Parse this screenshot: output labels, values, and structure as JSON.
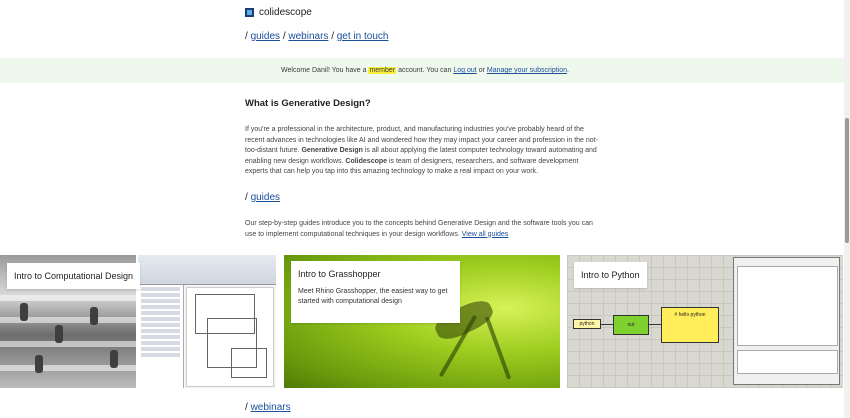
{
  "header": {
    "logo_text": "colidescope",
    "nav": {
      "sep1": "/",
      "guides": "guides",
      "sep2": "/",
      "webinars": "webinars",
      "sep3": "/",
      "contact": "get in touch"
    }
  },
  "welcome": {
    "prefix": "Welcome Danil! You have a",
    "member": "member",
    "middle": "account. You can",
    "logout": "Log out",
    "or": "or",
    "manage": "Manage your subscription",
    "end": "."
  },
  "about": {
    "heading": "What is Generative Design?",
    "text_a": "If you're a professional in the architecture, product, and manufacturing industries you've probably heard of the recent advances in technologies like AI and wondered how they may impact your career and profession in the not-too-distant future.",
    "bold_gd": "Generative Design",
    "text_b": "is all about applying the latest computer technology toward automating and enabling new design workflows.",
    "bold_co": "Colidescope",
    "text_c": "is team of designers, researchers, and software development experts that can help you tap into this amazing technology to make a real impact on your work."
  },
  "guides": {
    "slash": "/",
    "heading": "guides",
    "intro": "Our step-by-step guides introduce you to the concepts behind Generative Design and the software tools you can use to implement computational techniques in your design workflows.",
    "view_all": "View all guides"
  },
  "cards": [
    {
      "title": "Intro to Computational Design"
    },
    {
      "title": "Intro to Grasshopper",
      "desc": "Meet Rhino Grasshopper, the easiest way to get started with computational design"
    },
    {
      "title": "Intro to Python"
    }
  ],
  "python_card": {
    "node_a": "python",
    "node_b": "out",
    "node_c": "# hello python"
  },
  "webinars": {
    "slash": "/",
    "heading": "webinars"
  }
}
